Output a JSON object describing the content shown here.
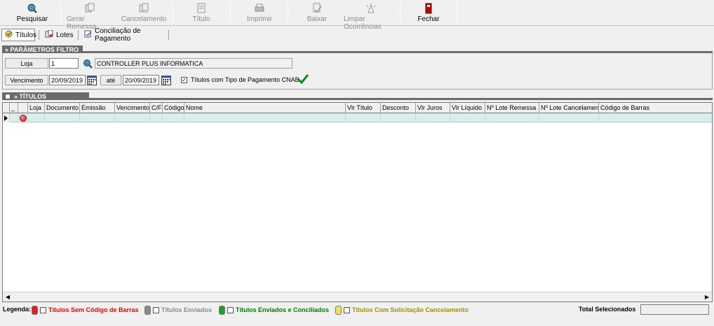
{
  "toolbar": {
    "pesquisar": "Pesquisar",
    "gerar_remessa": "Gerar Remessa",
    "cancelamento": "Cancelamento",
    "titulo": "Título",
    "imprimir": "Imprimir",
    "baixar": "Baixar",
    "limpar_ocorrencias": "Limpar Ocorrências",
    "fechar": "Fechar"
  },
  "tabs": [
    {
      "label": "Títulos",
      "active": true
    },
    {
      "label": "Lotes",
      "active": false
    },
    {
      "label": "Conciliação de Pagamento",
      "active": false
    }
  ],
  "filtro": {
    "header": "» PARÂMETROS FILTRO",
    "loja_label": "Loja",
    "loja_value": "1",
    "loja_nome": "CONTROLLER PLUS INFORMATICA",
    "vencimento_label": "Vencimento",
    "venc_de": "20/09/2019",
    "ate_label": "até",
    "venc_ate": "20/09/2019",
    "cnab_label": "Títulos com Tipo de Pagamento CNAB",
    "cnab_checked": "✓"
  },
  "titulos": {
    "header": "» TÍTULOS",
    "columns": [
      "_",
      "",
      "Loja",
      "Documento",
      "Emissão",
      "Vencimento",
      "C/F",
      "Código",
      "Nome",
      "Vlr Título",
      "Desconto",
      "Vlr Juros",
      "Vlr Líquido",
      "Nº Lote Remessa",
      "Nº Lote Cancelamento",
      "Código de Barras"
    ]
  },
  "legend": {
    "title": "Legenda:",
    "items": [
      {
        "label": "Títulos Sem Código de Barras",
        "color": "#e00000"
      },
      {
        "label": "Títulos Enviados",
        "color": "#8a8a8a"
      },
      {
        "label": "Títulos Enviados e Conciliados",
        "color": "#007a00"
      },
      {
        "label": "Títulos Com Solicitação Cancelamento",
        "color": "#a09000"
      }
    ],
    "total_label": "Total Selecionados"
  },
  "colors": {
    "section_header": "#6b6b6b",
    "row_selected": "#d6f0ee"
  }
}
